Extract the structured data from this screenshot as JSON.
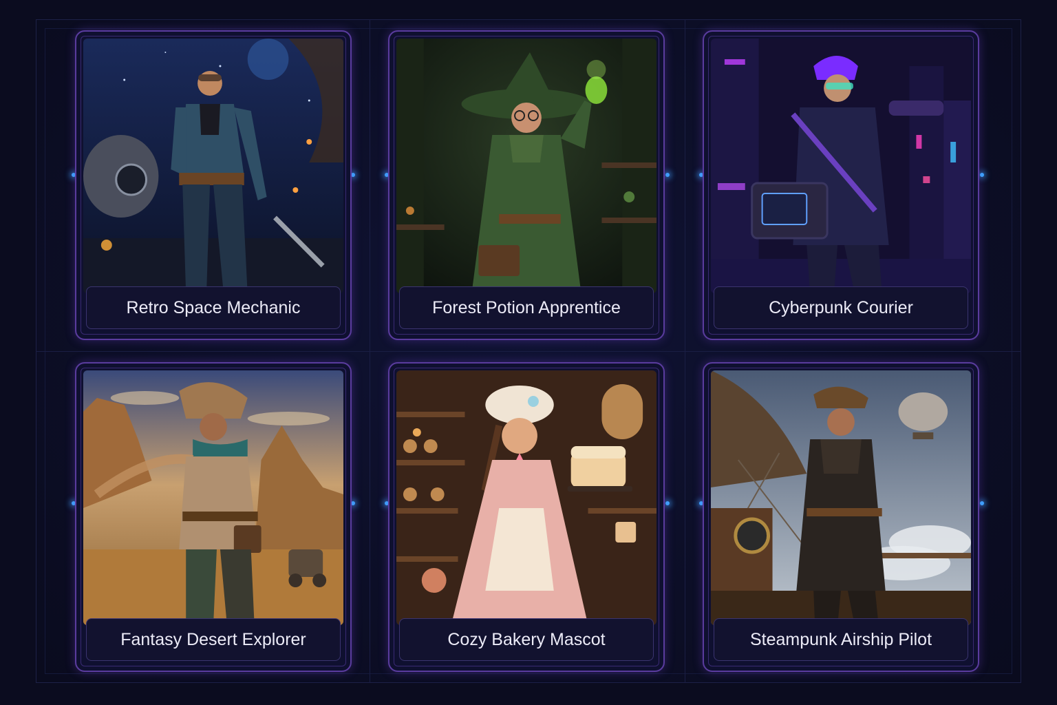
{
  "gallery": {
    "cards": [
      {
        "title": "Retro Space Mechanic",
        "theme": "space-hangar",
        "accent": "#2a4a8a"
      },
      {
        "title": "Forest Potion Apprentice",
        "theme": "forest-witch",
        "accent": "#2f5a2a"
      },
      {
        "title": "Cyberpunk Courier",
        "theme": "neon-city",
        "accent": "#6a2cc0"
      },
      {
        "title": "Fantasy Desert Explorer",
        "theme": "desert",
        "accent": "#c08a40"
      },
      {
        "title": "Cozy Bakery Mascot",
        "theme": "bakery",
        "accent": "#b0703a"
      },
      {
        "title": "Steampunk Airship Pilot",
        "theme": "airship",
        "accent": "#8a6a44"
      }
    ]
  },
  "colors": {
    "background": "#0b0c1f",
    "card_border": "#5a3c9e",
    "connector_dot": "#3aa8ff",
    "label_text": "#ecebf7"
  }
}
